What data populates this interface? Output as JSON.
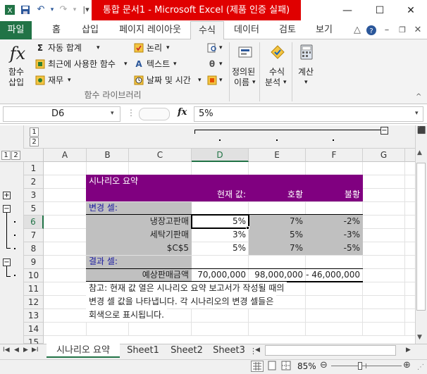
{
  "window": {
    "title": "통합 문서1 - Microsoft Excel (제품 인증 실패)"
  },
  "tabs": [
    "파일",
    "홈",
    "삽입",
    "페이지 레이아웃",
    "수식",
    "데이터",
    "검토",
    "보기"
  ],
  "ribbon": {
    "insert_function": "함수\n삽입",
    "insert_function_l1": "함수",
    "insert_function_l2": "삽입",
    "autosum": "자동 합계",
    "recent": "최근에 사용한 함수",
    "financial": "재무",
    "logical": "논리",
    "text": "텍스트",
    "datetime": "날짜 및 시간",
    "group_label": "함수 라이브러리",
    "defined_names_l1": "정의된",
    "defined_names_l2": "이름",
    "formula_auditing_l1": "수식",
    "formula_auditing_l2": "분석",
    "calculation": "계산"
  },
  "formula_bar": {
    "name_box": "D6",
    "fx": "fx",
    "value": "5%"
  },
  "columns": [
    "A",
    "B",
    "C",
    "D",
    "E",
    "F",
    "G"
  ],
  "outline_levels_col": [
    "1",
    "2"
  ],
  "outline_levels_row": [
    "1",
    "2"
  ],
  "rows": [
    "1",
    "2",
    "3",
    "5",
    "6",
    "7",
    "8",
    "9",
    "10",
    "11",
    "12",
    "13",
    "14",
    "15"
  ],
  "cells": {
    "title": "시나리오 요약",
    "hdr_current": "현재 값:",
    "hdr_boom": "호황",
    "hdr_bust": "불황",
    "changing": "변경 셀:",
    "r6_label": "냉장고판매",
    "r6_d": "5%",
    "r6_e": "7%",
    "r6_f": "-2%",
    "r7_label": "세탁기판매",
    "r7_d": "3%",
    "r7_e": "5%",
    "r7_f": "-3%",
    "r8_label": "$C$5",
    "r8_d": "5%",
    "r8_e": "7%",
    "r8_f": "-5%",
    "result": "결과 셀:",
    "r10_label": "예상판매금액",
    "r10_d": "70,000,000",
    "r10_e": "98,000,000",
    "r10_f": "- 46,000,000",
    "note1": "참고: 현재 값 열은 시나리오 요약 보고서가 작성될 때의",
    "note2": "변경 셀 값을 나타냅니다. 각 시나리오의 변경 셀들은",
    "note3": "회색으로 표시됩니다."
  },
  "sheets": [
    "시나리오 요약",
    "Sheet1",
    "Sheet2",
    "Sheet3"
  ],
  "status": {
    "zoom": "85%"
  },
  "colors": {
    "accent": "#217346",
    "title_red": "#e00000",
    "purple": "#800080",
    "gray": "#c0c0c0"
  }
}
